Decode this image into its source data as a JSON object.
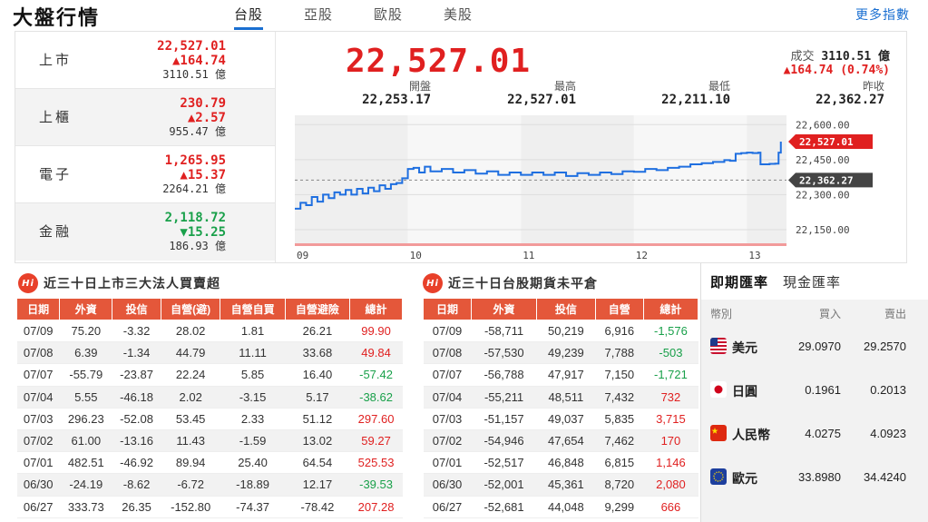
{
  "header": {
    "title": "大盤行情",
    "tabs": [
      "台股",
      "亞股",
      "歐股",
      "美股"
    ],
    "more": "更多指數"
  },
  "indices": [
    {
      "name": "上市",
      "price": "22,527.01",
      "change": "▲164.74",
      "direction": "up",
      "volume": "3110.51 億"
    },
    {
      "name": "上櫃",
      "price": "230.79",
      "change": "▲2.57",
      "direction": "up",
      "volume": "955.47 億"
    },
    {
      "name": "電子",
      "price": "1,265.95",
      "change": "▲15.37",
      "direction": "up",
      "volume": "2264.21 億"
    },
    {
      "name": "金融",
      "price": "2,118.72",
      "change": "▼15.25",
      "direction": "down",
      "volume": "186.93 億"
    }
  ],
  "main": {
    "price": "22,527.01",
    "volume_label": "成交",
    "volume": "3110.51 億",
    "change": "▲164.74 (0.74%)",
    "ohlc": [
      {
        "label": "開盤",
        "value": "22,253.17"
      },
      {
        "label": "最高",
        "value": "22,527.01"
      },
      {
        "label": "最低",
        "value": "22,211.10"
      },
      {
        "label": "昨收",
        "value": "22,362.27"
      }
    ]
  },
  "chart_data": {
    "type": "line",
    "x_ticks": [
      "09",
      "10",
      "11",
      "12",
      "13"
    ],
    "y_ticks": [
      "22,600.00",
      "22,450.00",
      "22,300.00",
      "22,150.00"
    ],
    "y_tick_values": [
      22600,
      22450,
      22300,
      22150
    ],
    "ylim": [
      22080,
      22640
    ],
    "xlim": [
      0,
      4.35
    ],
    "last_label": "22,527.01",
    "last_value": 22527.01,
    "prev_close_label": "22,362.27",
    "prev_close_value": 22362.27,
    "colors": {
      "line": "#1f6fe0",
      "last": "#e02020",
      "prev": "#444444"
    },
    "series": [
      {
        "values": [
          [
            0.0,
            22240
          ],
          [
            0.05,
            22265
          ],
          [
            0.1,
            22255
          ],
          [
            0.15,
            22290
          ],
          [
            0.2,
            22270
          ],
          [
            0.25,
            22300
          ],
          [
            0.3,
            22285
          ],
          [
            0.35,
            22310
          ],
          [
            0.4,
            22300
          ],
          [
            0.45,
            22320
          ],
          [
            0.5,
            22300
          ],
          [
            0.55,
            22325
          ],
          [
            0.6,
            22305
          ],
          [
            0.65,
            22330
          ],
          [
            0.7,
            22315
          ],
          [
            0.75,
            22340
          ],
          [
            0.8,
            22325
          ],
          [
            0.85,
            22345
          ],
          [
            0.9,
            22350
          ],
          [
            0.95,
            22370
          ],
          [
            1.0,
            22410
          ],
          [
            1.05,
            22415
          ],
          [
            1.1,
            22395
          ],
          [
            1.15,
            22420
          ],
          [
            1.2,
            22400
          ],
          [
            1.3,
            22410
          ],
          [
            1.4,
            22395
          ],
          [
            1.5,
            22405
          ],
          [
            1.6,
            22390
          ],
          [
            1.7,
            22400
          ],
          [
            1.8,
            22385
          ],
          [
            1.9,
            22395
          ],
          [
            2.0,
            22385
          ],
          [
            2.1,
            22395
          ],
          [
            2.2,
            22385
          ],
          [
            2.3,
            22395
          ],
          [
            2.4,
            22380
          ],
          [
            2.5,
            22392
          ],
          [
            2.6,
            22385
          ],
          [
            2.7,
            22395
          ],
          [
            2.8,
            22388
          ],
          [
            2.9,
            22400
          ],
          [
            3.0,
            22398
          ],
          [
            3.1,
            22410
          ],
          [
            3.2,
            22405
          ],
          [
            3.3,
            22415
          ],
          [
            3.4,
            22420
          ],
          [
            3.5,
            22430
          ],
          [
            3.6,
            22435
          ],
          [
            3.7,
            22440
          ],
          [
            3.8,
            22448
          ],
          [
            3.85,
            22445
          ],
          [
            3.9,
            22475
          ],
          [
            3.95,
            22478
          ],
          [
            4.0,
            22480
          ],
          [
            4.05,
            22478
          ],
          [
            4.1,
            22480
          ],
          [
            4.12,
            22430
          ],
          [
            4.2,
            22432
          ],
          [
            4.25,
            22433
          ],
          [
            4.28,
            22480
          ],
          [
            4.3,
            22527
          ]
        ]
      }
    ]
  },
  "inst_table": {
    "title": "近三十日上市三大法人買賣超",
    "headers": [
      "日期",
      "外資",
      "投信",
      "自營(避)",
      "自營自買",
      "自營避險",
      "總計"
    ],
    "rows": [
      [
        "07/09",
        "75.20",
        "-3.32",
        "28.02",
        "1.81",
        "26.21",
        "99.90"
      ],
      [
        "07/08",
        "6.39",
        "-1.34",
        "44.79",
        "11.11",
        "33.68",
        "49.84"
      ],
      [
        "07/07",
        "-55.79",
        "-23.87",
        "22.24",
        "5.85",
        "16.40",
        "-57.42"
      ],
      [
        "07/04",
        "5.55",
        "-46.18",
        "2.02",
        "-3.15",
        "5.17",
        "-38.62"
      ],
      [
        "07/03",
        "296.23",
        "-52.08",
        "53.45",
        "2.33",
        "51.12",
        "297.60"
      ],
      [
        "07/02",
        "61.00",
        "-13.16",
        "11.43",
        "-1.59",
        "13.02",
        "59.27"
      ],
      [
        "07/01",
        "482.51",
        "-46.92",
        "89.94",
        "25.40",
        "64.54",
        "525.53"
      ],
      [
        "06/30",
        "-24.19",
        "-8.62",
        "-6.72",
        "-18.89",
        "12.17",
        "-39.53"
      ],
      [
        "06/27",
        "333.73",
        "26.35",
        "-152.80",
        "-74.37",
        "-78.42",
        "207.28"
      ]
    ]
  },
  "fut_table": {
    "title": "近三十日台股期貨未平倉",
    "headers": [
      "日期",
      "外資",
      "投信",
      "自營",
      "總計"
    ],
    "rows": [
      [
        "07/09",
        "-58,711",
        "50,219",
        "6,916",
        "-1,576"
      ],
      [
        "07/08",
        "-57,530",
        "49,239",
        "7,788",
        "-503"
      ],
      [
        "07/07",
        "-56,788",
        "47,917",
        "7,150",
        "-1,721"
      ],
      [
        "07/04",
        "-55,211",
        "48,511",
        "7,432",
        "732"
      ],
      [
        "07/03",
        "-51,157",
        "49,037",
        "5,835",
        "3,715"
      ],
      [
        "07/02",
        "-54,946",
        "47,654",
        "7,462",
        "170"
      ],
      [
        "07/01",
        "-52,517",
        "46,848",
        "6,815",
        "1,146"
      ],
      [
        "06/30",
        "-52,001",
        "45,361",
        "8,720",
        "2,080"
      ],
      [
        "06/27",
        "-52,681",
        "44,048",
        "9,299",
        "666"
      ]
    ]
  },
  "fx": {
    "tabs": [
      "即期匯率",
      "現金匯率"
    ],
    "headers": {
      "currency": "幣別",
      "buy": "買入",
      "sell": "賣出"
    },
    "rows": [
      {
        "name": "美元",
        "flag": "us-flag-icon",
        "buy": "29.0970",
        "sell": "29.2570"
      },
      {
        "name": "日圓",
        "flag": "jp-flag-icon",
        "buy": "0.1961",
        "sell": "0.2013"
      },
      {
        "name": "人民幣",
        "flag": "cn-flag-icon",
        "buy": "4.0275",
        "sell": "4.0923"
      },
      {
        "name": "歐元",
        "flag": "eu-flag-icon",
        "buy": "33.8980",
        "sell": "34.4240"
      }
    ]
  },
  "colors": {
    "up": "#e02020",
    "down": "#19a04a",
    "accent": "#1a6fd1",
    "table_header": "#e4573a"
  }
}
